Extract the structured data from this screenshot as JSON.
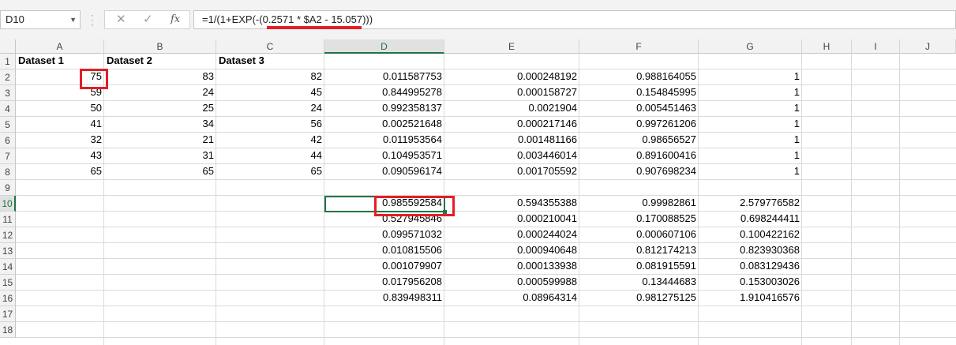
{
  "name_box": "D10",
  "formula": "=1/(1+EXP(-(0.2571 * $A2 - 15.057)))",
  "icons": {
    "cancel": "close-icon",
    "enter": "check-icon",
    "function": "fx-icon"
  },
  "columns": [
    "A",
    "B",
    "C",
    "D",
    "E",
    "F",
    "G",
    "H",
    "I",
    "J"
  ],
  "rows": [
    "1",
    "2",
    "3",
    "4",
    "5",
    "6",
    "7",
    "8",
    "9",
    "10",
    "11",
    "12",
    "13",
    "14",
    "15",
    "16",
    "17",
    "18"
  ],
  "cells": {
    "r1": [
      "Dataset 1",
      "Dataset 2",
      "Dataset 3"
    ],
    "r2": [
      "75",
      "83",
      "82",
      "0.011587753",
      "0.000248192",
      "0.988164055",
      "1"
    ],
    "r3": [
      "59",
      "24",
      "45",
      "0.844995278",
      "0.000158727",
      "0.154845995",
      "1"
    ],
    "r4": [
      "50",
      "25",
      "24",
      "0.992358137",
      "0.0021904",
      "0.005451463",
      "1"
    ],
    "r5": [
      "41",
      "34",
      "56",
      "0.002521648",
      "0.000217146",
      "0.997261206",
      "1"
    ],
    "r6": [
      "32",
      "21",
      "42",
      "0.011953564",
      "0.001481166",
      "0.98656527",
      "1"
    ],
    "r7": [
      "43",
      "31",
      "44",
      "0.104953571",
      "0.003446014",
      "0.891600416",
      "1"
    ],
    "r8": [
      "65",
      "65",
      "65",
      "0.090596174",
      "0.001705592",
      "0.907698234",
      "1"
    ],
    "r10": [
      "0.985592584",
      "0.594355388",
      "0.99982861",
      "2.579776582"
    ],
    "r11": [
      "0.527945846",
      "0.000210041",
      "0.170088525",
      "0.698244411"
    ],
    "r12": [
      "0.099571032",
      "0.000244024",
      "0.000607106",
      "0.100422162"
    ],
    "r13": [
      "0.010815506",
      "0.000940648",
      "0.812174213",
      "0.823930368"
    ],
    "r14": [
      "0.001079907",
      "0.000133938",
      "0.081915591",
      "0.083129436"
    ],
    "r15": [
      "0.017956208",
      "0.000599988",
      "0.13444683",
      "0.153003026"
    ],
    "r16": [
      "0.839498311",
      "0.08964314",
      "0.981275125",
      "1.910416576"
    ]
  },
  "colors": {
    "accent": "#217346",
    "highlight": "#e21f26"
  }
}
